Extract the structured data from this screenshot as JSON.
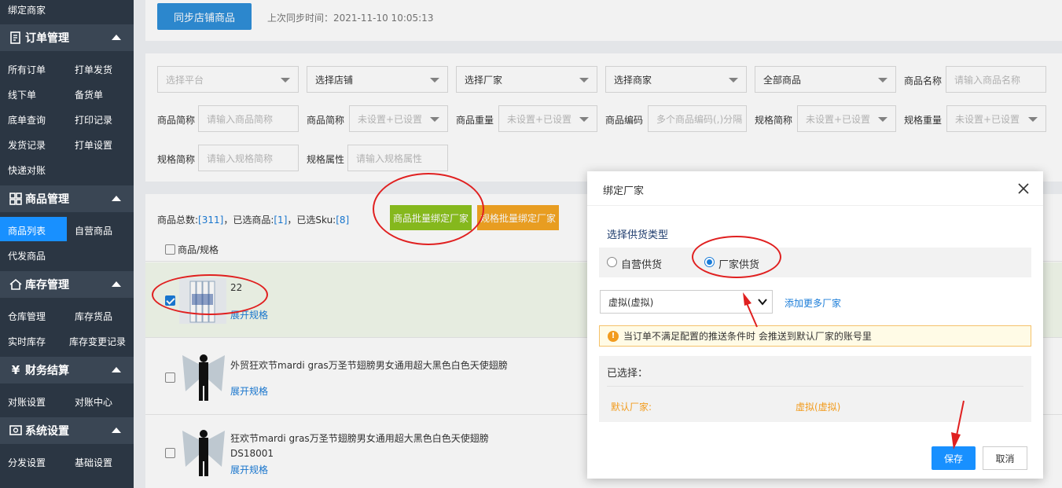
{
  "sidebar": {
    "top_item": "绑定商家",
    "sections": [
      {
        "title": "订单管理",
        "icon": "order-icon"
      },
      {
        "title": "商品管理",
        "icon": "grid-icon"
      },
      {
        "title": "库存管理",
        "icon": "home-icon"
      },
      {
        "title": "财务结算",
        "icon": "yen-icon"
      },
      {
        "title": "系统设置",
        "icon": "settings-icon"
      }
    ],
    "order_items": [
      "所有订单",
      "打单发货",
      "线下单",
      "备货单",
      "底单查询",
      "打印记录",
      "发货记录",
      "打单设置",
      "快递对账"
    ],
    "goods_items": [
      "商品列表",
      "自营商品",
      "代发商品"
    ],
    "stock_items": [
      "仓库管理",
      "库存货品",
      "实时库存",
      "库存变更记录"
    ],
    "finance_items": [
      "对账设置",
      "对账中心"
    ],
    "system_items": [
      "分发设置",
      "基础设置"
    ]
  },
  "sync": {
    "button": "同步店铺商品",
    "last_sync": "上次同步时间：2021-11-10 10:05:13"
  },
  "filters": {
    "platform": "选择平台",
    "shop": "选择店铺",
    "factory": "选择厂家",
    "merchant": "选择商家",
    "goods_scope": "全部商品",
    "goods_name_label": "商品名称",
    "goods_name_ph": "请输入商品名称",
    "short_label_1": "商品简称",
    "short_ph": "请输入商品简称",
    "short_label_2": "商品简称",
    "short_sel": "未设置+已设置",
    "weight_label": "商品重量",
    "weight_sel": "未设置+已设置",
    "code_label": "商品编码",
    "code_ph": "多个商品编码(,)分隔",
    "spec_short_label": "规格简称",
    "spec_short_sel": "未设置+已设置",
    "spec_weight_label": "规格重量",
    "spec_weight_sel": "未设置+已设置",
    "spec_short_label_2": "规格简称",
    "spec_short_ph": "请输入规格简称",
    "spec_attr_label": "规格属性",
    "spec_attr_ph": "请输入规格属性"
  },
  "list": {
    "total_label": "商品总数:",
    "total": "[311]",
    "selected_label": "，已选商品:",
    "selected": "[1]",
    "sku_label": "，已选Sku:",
    "sku": "[8]",
    "bind_goods_btn": "商品批量绑定厂家",
    "bind_spec_btn": "规格批量绑定厂家",
    "header": "商品/规格",
    "expand": "展开规格",
    "rows": [
      {
        "name": "22",
        "code": "",
        "checked": true
      },
      {
        "name": "外贸狂欢节mardi gras万圣节翅膀男女通用超大黑色白色天使翅膀",
        "code": "",
        "checked": false
      },
      {
        "name": "狂欢节mardi gras万圣节翅膀男女通用超大黑色白色天使翅膀",
        "code": "DS18001",
        "checked": false
      }
    ]
  },
  "dialog": {
    "title": "绑定厂家",
    "section": "选择供货类型",
    "opt_self": "自营供货",
    "opt_factory": "厂家供货",
    "selected_option": "厂家供货",
    "factory_value": "虚拟(虚拟)",
    "add_more": "添加更多厂家",
    "notice": "当订单不满足配置的推送条件时 会推送到默认厂家的账号里",
    "chosen_label": "已选择：",
    "default_label": "默认厂家:",
    "default_value": "虚拟(虚拟)",
    "save": "保存",
    "cancel": "取消"
  },
  "colors": {
    "sidebar_bg": "#2b3643",
    "accent": "#1890ff",
    "green_btn": "#8dc21f",
    "orange_btn": "#f5a623",
    "annotation_red": "#e02020",
    "notice_bg": "#fffbe6"
  }
}
